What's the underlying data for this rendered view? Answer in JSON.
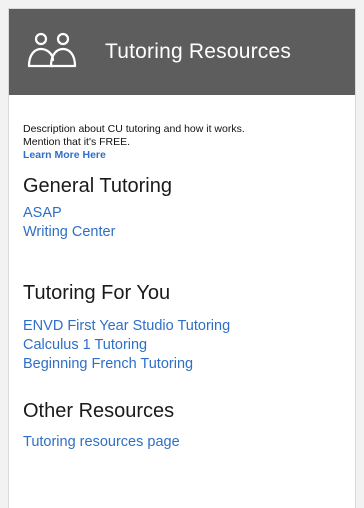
{
  "header": {
    "icon": "people-icon",
    "title": "Tutoring Resources",
    "bg_color": "#5d5d5d"
  },
  "intro": {
    "description_line1": "Description about CU tutoring and how it works.",
    "description_line2": "Mention that it's FREE.",
    "learn_more": "Learn More Here"
  },
  "sections": [
    {
      "title": "General Tutoring",
      "links": [
        "ASAP",
        "Writing Center"
      ]
    },
    {
      "title": "Tutoring For You",
      "links": [
        "ENVD First Year Studio Tutoring",
        "Calculus 1 Tutoring",
        "Beginning French Tutoring"
      ]
    },
    {
      "title": "Other Resources",
      "links": [
        "Tutoring resources page"
      ]
    }
  ],
  "colors": {
    "link": "#2f6fc7",
    "text": "#111111"
  }
}
